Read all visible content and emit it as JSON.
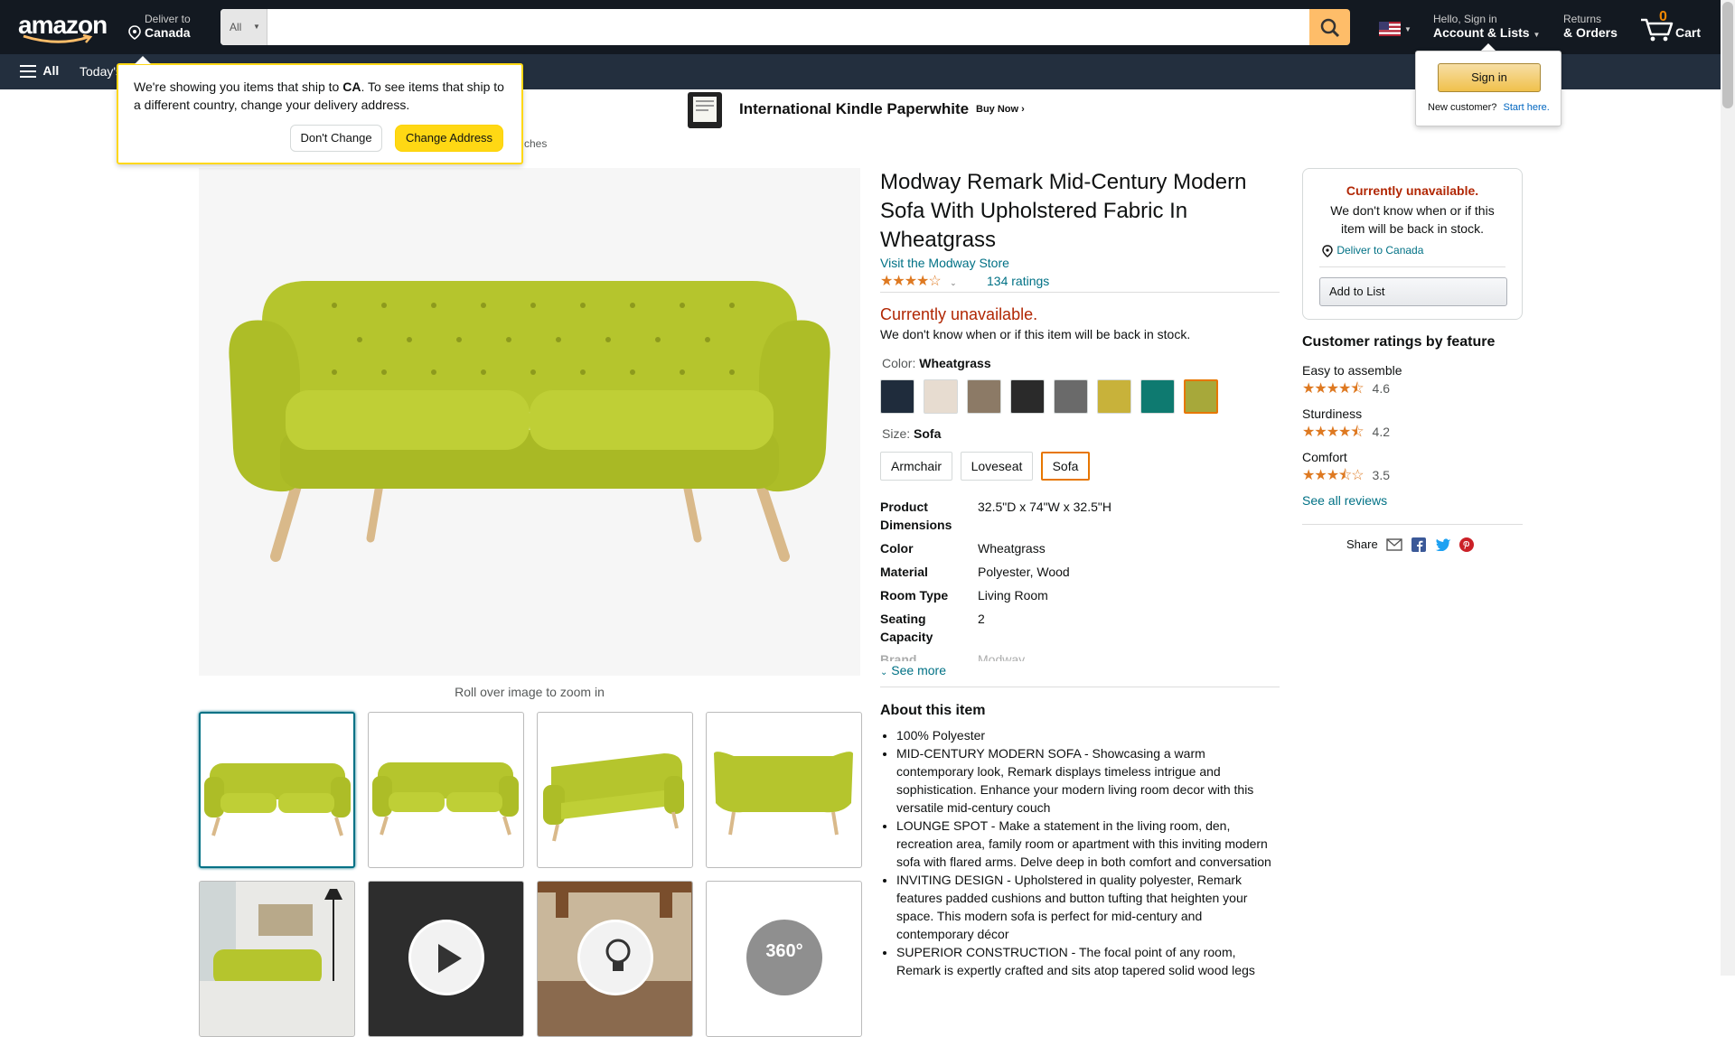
{
  "nav": {
    "logo": "amazon",
    "deliver_line1": "Deliver to",
    "deliver_line2": "Canada",
    "search_category": "All",
    "search_placeholder": "",
    "greeting": "Hello, Sign in",
    "account": "Account & Lists",
    "returns_line1": "Returns",
    "returns_line2": "& Orders",
    "cart_count": "0",
    "cart_label": "Cart"
  },
  "subnav": {
    "all_label": "All",
    "items": [
      "Today's"
    ]
  },
  "banner": {
    "title": "International Kindle Paperwhite",
    "cta": "Buy Now ›"
  },
  "breadcrumb_fragment": "ches",
  "address_popup": {
    "text_before": "We're showing you items that ship to ",
    "country": "CA",
    "text_after": ". To see items that ship to a different country, change your delivery address.",
    "dont_change": "Don't Change",
    "change_address": "Change Address"
  },
  "signin_popup": {
    "button": "Sign in",
    "new_customer": "New customer?",
    "start_here": "Start here."
  },
  "product": {
    "title": "Modway Remark Mid-Century Modern Sofa With Upholstered Fabric In Wheatgrass",
    "store_link": "Visit the Modway Store",
    "rating": 3.9,
    "ratings_count": "134 ratings",
    "availability": "Currently unavailable.",
    "availability_note": "We don't know when or if this item will be back in stock.",
    "color_label": "Color:",
    "color_value": "Wheatgrass",
    "size_label": "Size:",
    "size_value": "Sofa",
    "sizes": [
      "Armchair",
      "Loveseat",
      "Sofa"
    ],
    "swatch_colors": [
      "#1f2c3c",
      "#e7dcd0",
      "#8c7a66",
      "#2a2a2a",
      "#6a6a6a",
      "#c8b23a",
      "#0e7a70",
      "#a7a83a"
    ],
    "specs": [
      {
        "k": "Product Dimensions",
        "v": "32.5\"D x 74\"W x 32.5\"H"
      },
      {
        "k": "Color",
        "v": "Wheatgrass"
      },
      {
        "k": "Material",
        "v": "Polyester, Wood"
      },
      {
        "k": "Room Type",
        "v": "Living Room"
      },
      {
        "k": "Seating Capacity",
        "v": "2"
      },
      {
        "k": "Brand",
        "v": "Modway"
      }
    ],
    "see_more": "See more",
    "zoom_hint": "Roll over image to zoom in",
    "about_title": "About this item",
    "bullets": [
      "100% Polyester",
      "MID-CENTURY MODERN SOFA - Showcasing a warm contemporary look, Remark displays timeless intrigue and sophistication. Enhance your modern living room decor with this versatile mid-century couch",
      "LOUNGE SPOT - Make a statement in the living room, den, recreation area, family room or apartment with this inviting modern sofa with flared arms. Delve deep in both comfort and conversation",
      "INVITING DESIGN - Upholstered in quality polyester, Remark features padded cushions and button tufting that heighten your space. This modern sofa is perfect for mid-century and contemporary décor",
      "SUPERIOR CONSTRUCTION - The focal point of any room, Remark is expertly crafted and sits atop tapered solid wood legs"
    ],
    "thumb_360": "360°"
  },
  "buybox": {
    "unavailable": "Currently unavailable.",
    "note": "We don't know when or if this item will be back in stock.",
    "deliver": "Deliver to Canada",
    "add_to_list": "Add to List"
  },
  "features": {
    "title": "Customer ratings by feature",
    "items": [
      {
        "name": "Easy to assemble",
        "score": "4.6"
      },
      {
        "name": "Sturdiness",
        "score": "4.2"
      },
      {
        "name": "Comfort",
        "score": "3.5"
      }
    ],
    "see_all": "See all reviews"
  },
  "share_label": "Share",
  "colors": {
    "nav": "#131921",
    "subnav": "#232f3e",
    "accent": "#febd69",
    "link": "#007185",
    "price_red": "#b12704",
    "star": "#de7921"
  }
}
